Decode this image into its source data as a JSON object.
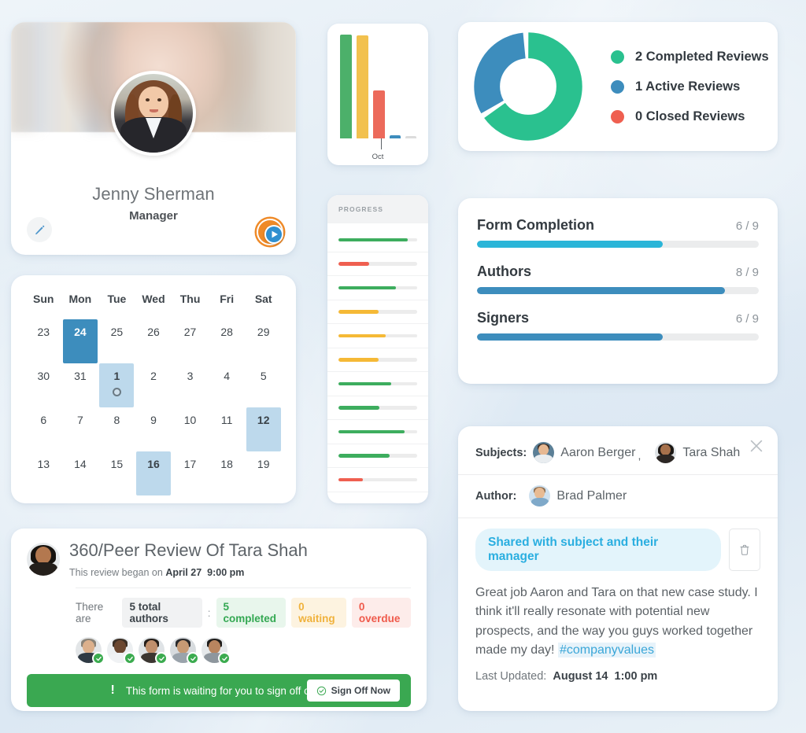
{
  "profile": {
    "name": "Jenny Sherman",
    "role": "Manager",
    "edit_icon": "pencil-icon",
    "help_icon": "question-mark-icon",
    "play_icon": "play-icon"
  },
  "calendar": {
    "weekdays": [
      "Sun",
      "Mon",
      "Tue",
      "Wed",
      "Thu",
      "Fri",
      "Sat"
    ],
    "days": [
      {
        "n": "23",
        "state": "none"
      },
      {
        "n": "24",
        "state": "selected-dark"
      },
      {
        "n": "25",
        "state": "none"
      },
      {
        "n": "26",
        "state": "none"
      },
      {
        "n": "27",
        "state": "none"
      },
      {
        "n": "28",
        "state": "none"
      },
      {
        "n": "29",
        "state": "none"
      },
      {
        "n": "30",
        "state": "none"
      },
      {
        "n": "31",
        "state": "none"
      },
      {
        "n": "1",
        "state": "selected-light",
        "marker": "event-dot"
      },
      {
        "n": "2",
        "state": "none"
      },
      {
        "n": "3",
        "state": "none"
      },
      {
        "n": "4",
        "state": "none"
      },
      {
        "n": "5",
        "state": "none"
      },
      {
        "n": "6",
        "state": "none"
      },
      {
        "n": "7",
        "state": "none"
      },
      {
        "n": "8",
        "state": "none"
      },
      {
        "n": "9",
        "state": "none"
      },
      {
        "n": "10",
        "state": "none"
      },
      {
        "n": "11",
        "state": "none"
      },
      {
        "n": "12",
        "state": "selected-light"
      },
      {
        "n": "13",
        "state": "none"
      },
      {
        "n": "14",
        "state": "none"
      },
      {
        "n": "15",
        "state": "none"
      },
      {
        "n": "16",
        "state": "selected-light"
      },
      {
        "n": "17",
        "state": "none"
      },
      {
        "n": "18",
        "state": "none"
      },
      {
        "n": "19",
        "state": "none"
      }
    ]
  },
  "progress_panel": {
    "header": "PROGRESS",
    "rows": [
      {
        "pct": 88,
        "color": "#3dad5e"
      },
      {
        "pct": 39,
        "color": "#ef5f50"
      },
      {
        "pct": 73,
        "color": "#3dad5e"
      },
      {
        "pct": 51,
        "color": "#f5b936"
      },
      {
        "pct": 60,
        "color": "#f5b936"
      },
      {
        "pct": 51,
        "color": "#f5b936"
      },
      {
        "pct": 67,
        "color": "#3dad5e"
      },
      {
        "pct": 52,
        "color": "#3dad5e"
      },
      {
        "pct": 84,
        "color": "#3dad5e"
      },
      {
        "pct": 65,
        "color": "#3dad5e"
      },
      {
        "pct": 31,
        "color": "#ef5f50"
      }
    ]
  },
  "metrics": {
    "items": [
      {
        "name": "Form Completion",
        "count": "6 / 9",
        "pct": 66,
        "color": "#2ab5d8"
      },
      {
        "name": "Authors",
        "count": "8 / 9",
        "pct": 88,
        "color": "#3d8dbd"
      },
      {
        "name": "Signers",
        "count": "6 / 9",
        "pct": 66,
        "color": "#3d8dbd"
      }
    ]
  },
  "review": {
    "title": "360/Peer Review Of Tara Shah",
    "subject_avatar": "tara-shah-avatar",
    "began_prefix": "This review began on",
    "began_date": "April 27",
    "began_time": "9:00 pm",
    "there_are": "There are",
    "total_authors": "5 total authors",
    "colon": ":",
    "completed": "5 completed",
    "waiting": "0 waiting",
    "overdue": "0 overdue",
    "author_count": 5,
    "banner_text": "This form is waiting for you to sign off on it.",
    "banner_button": "Sign Off Now",
    "banner_color": "#3aa851"
  },
  "comment": {
    "subjects_label": "Subjects:",
    "subject_1": "Aaron Berger",
    "subject_separator": ",",
    "subject_2": "Tara Shah",
    "author_label": "Author:",
    "author_name": "Brad Palmer",
    "share_pill": "Shared with subject and their manager",
    "trash_icon": "trash-icon",
    "close_icon": "close-icon",
    "body_text": "Great job Aaron and Tara on that new case study. I think it'll really resonate with potential new prospects, and the way you guys worked together made my day!",
    "hashtag": "#companyvalues",
    "updated_label": "Last Updated:",
    "updated_date": "August 14",
    "updated_time": "1:00 pm"
  },
  "chart_data": [
    {
      "type": "donut",
      "title": "",
      "legend_position": "right",
      "categories": [
        "Completed Reviews",
        "Active Reviews",
        "Closed Reviews"
      ],
      "values": [
        2,
        1,
        0
      ],
      "labels": [
        "2 Completed Reviews",
        "1 Active Reviews",
        "0 Closed Reviews"
      ],
      "colors": [
        "#2ac18f",
        "#3d8dbd",
        "#ef5f50"
      ]
    },
    {
      "type": "bar",
      "title": "",
      "xlabel": "",
      "ylabel": "",
      "categories": [
        "Oct",
        "",
        "",
        "",
        ""
      ],
      "tick_labels": [
        "Oct"
      ],
      "values": [
        100,
        99,
        46,
        3,
        1
      ],
      "ylim": [
        0,
        100
      ],
      "grid": false,
      "colors": [
        "#4cb06a",
        "#f2c14e",
        "#ec6a5b",
        "#3d8dbd",
        "#dcdcdc"
      ]
    }
  ]
}
